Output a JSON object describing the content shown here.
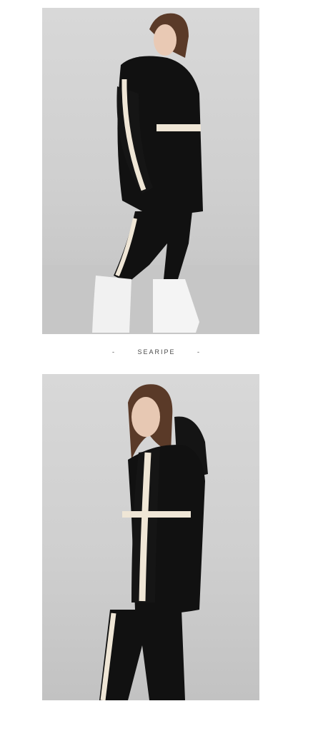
{
  "brand": {
    "name": "SEARIPE",
    "left_dash": "-",
    "right_dash": "-"
  },
  "photos": [
    {
      "subject": "model-standing-side-view"
    },
    {
      "subject": "model-hooded-close-view"
    }
  ],
  "colors": {
    "background": "#ffffff",
    "studio_backdrop": "#d3d3d3",
    "garment": "#111111",
    "tape": "#efe6d6",
    "boots": "#f1f1f1"
  }
}
